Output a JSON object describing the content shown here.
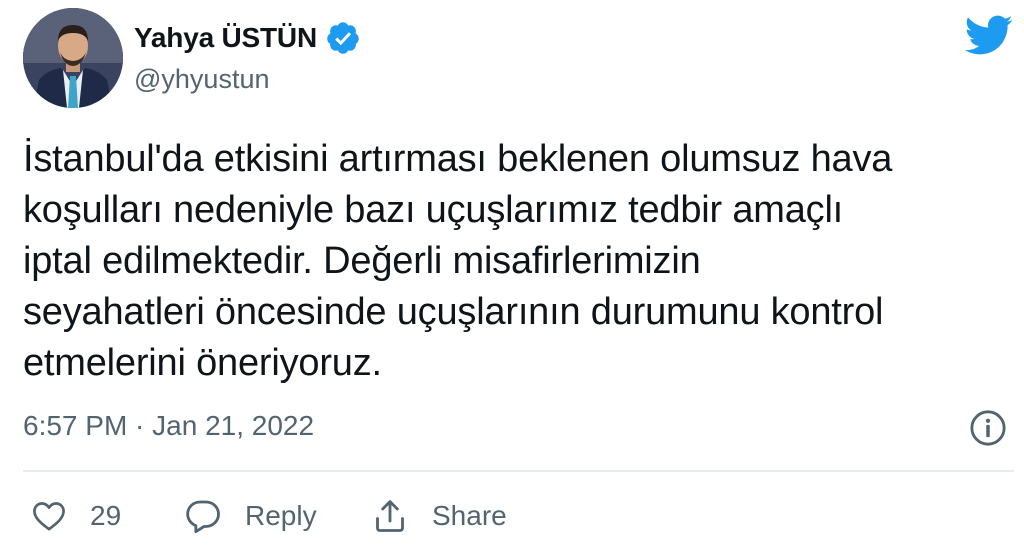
{
  "author": {
    "display_name": "Yahya ÜSTÜN",
    "handle": "@yhyustun",
    "verified": true,
    "avatar_icon": "profile-photo"
  },
  "brand": {
    "logo_icon": "twitter-bird-icon",
    "accent_color": "#1d9bf0"
  },
  "tweet": {
    "text_lines": [
      "İstanbul'da etkisini artırması beklenen olumsuz hava",
      "koşulları nedeniyle bazı uçuşlarımız tedbir amaçlı",
      "iptal edilmektedir. Değerli misafirlerimizin",
      "seyahatleri öncesinde uçuşlarının durumunu kontrol",
      "etmelerini öneriyoruz."
    ],
    "timestamp": "6:57 PM · Jan 21, 2022",
    "info_icon": "info-icon"
  },
  "actions": {
    "like_count": "29",
    "like_icon": "heart-icon",
    "reply_label": "Reply",
    "reply_icon": "speech-bubble-icon",
    "share_label": "Share",
    "share_icon": "share-arrow-icon"
  },
  "colors": {
    "text_primary": "#0f1419",
    "text_secondary": "#536471",
    "divider": "#e6ecf0"
  }
}
